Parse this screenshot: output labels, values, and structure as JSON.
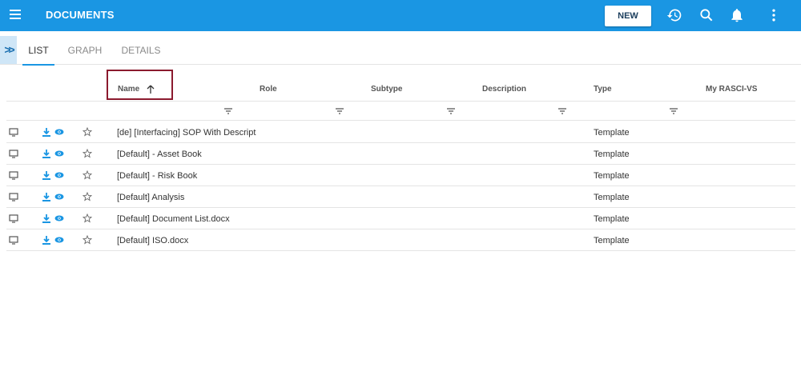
{
  "topbar": {
    "title": "DOCUMENTS",
    "new_label": "NEW",
    "icons": [
      "hamburger-menu-icon",
      "history-icon",
      "search-icon",
      "bell-icon",
      "more-vertical-icon"
    ],
    "color": "#1a96e3"
  },
  "tabs": [
    {
      "label": "LIST",
      "active": true
    },
    {
      "label": "GRAPH",
      "active": false
    },
    {
      "label": "DETAILS",
      "active": false
    }
  ],
  "expand_label": ">>",
  "columns": {
    "name": "Name",
    "role": "Role",
    "subtype": "Subtype",
    "description": "Description",
    "type": "Type",
    "rasci": "My RASCI-VS"
  },
  "sort": {
    "column": "name",
    "direction": "ascending"
  },
  "rows": [
    {
      "name": "[de] [Interfacing] SOP With Descript",
      "type": "Template"
    },
    {
      "name": "[Default] - Asset Book",
      "type": "Template"
    },
    {
      "name": "[Default] - Risk Book",
      "type": "Template"
    },
    {
      "name": "[Default] Analysis",
      "type": "Template"
    },
    {
      "name": "[Default] Document List.docx",
      "type": "Template"
    },
    {
      "name": "[Default] ISO.docx",
      "type": "Template"
    }
  ],
  "row_icons": [
    "monitor-icon",
    "download-icon",
    "eye-icon",
    "star-outline-icon"
  ],
  "accent": "#1a96e3",
  "highlight_border": "#8b1a2e"
}
